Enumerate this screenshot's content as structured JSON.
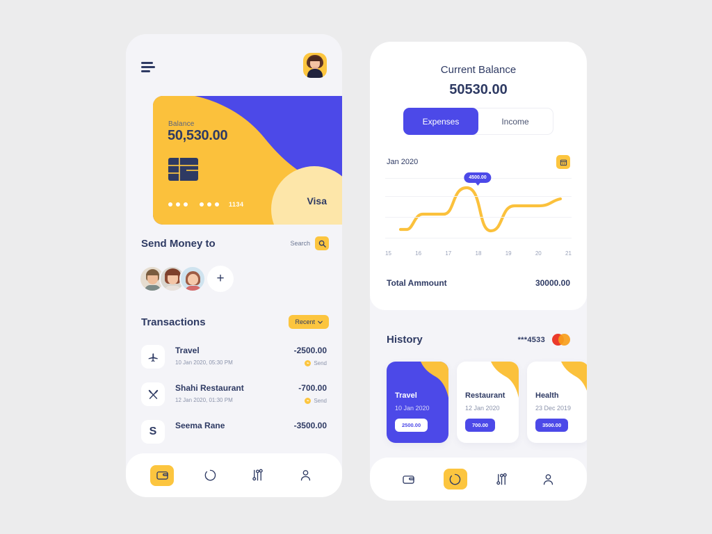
{
  "app": {
    "background_color": "#ececed",
    "accent_yellow": "#fcc53f",
    "accent_blue": "#4c49e8",
    "text_dark": "#2e3a63"
  },
  "left_screen": {
    "menu_icon": "hamburger-icon",
    "profile_avatar": "user-avatar",
    "card": {
      "balance_label": "Balance",
      "balance_value": "50,530.00",
      "chip_icon": "card-chip-icon",
      "masked_digits": [
        "•••",
        "•••"
      ],
      "last_four": "1134",
      "brand": "Visa"
    },
    "send_money": {
      "title": "Send Money to",
      "search_label": "Search",
      "search_icon": "search-icon",
      "add_label": "+",
      "friends": [
        {
          "name": "friend-1-avatar"
        },
        {
          "name": "friend-2-avatar"
        },
        {
          "name": "friend-3-avatar"
        }
      ]
    },
    "transactions": {
      "title": "Transactions",
      "filter_label": "Recent",
      "filter_icon": "chevron-down-icon",
      "items": [
        {
          "icon": "airplane-icon",
          "name": "Travel",
          "date": "10 Jan 2020, 05:30 PM",
          "amount": "-2500.00",
          "status": "Send"
        },
        {
          "icon": "cutlery-icon",
          "name": "Shahi Restaurant",
          "date": "12 Jan 2020, 01:30 PM",
          "amount": "-700.00",
          "status": "Send"
        },
        {
          "icon": "initial-letter",
          "initial": "S",
          "name": "Seema Rane",
          "date": "",
          "amount": "-3500.00",
          "status": ""
        }
      ]
    },
    "nav": [
      {
        "icon": "wallet-icon",
        "active": true
      },
      {
        "icon": "chart-ring-icon",
        "active": false
      },
      {
        "icon": "sliders-icon",
        "active": false
      },
      {
        "icon": "user-icon",
        "active": false
      }
    ]
  },
  "right_screen": {
    "balance_label": "Current Balance",
    "balance_value": "50530.00",
    "tabs": [
      {
        "label": "Expenses",
        "active": true
      },
      {
        "label": "Income",
        "active": false
      }
    ],
    "month_label": "Jan 2020",
    "calendar_icon": "calendar-icon",
    "total": {
      "label": "Total Ammount",
      "value": "30000.00"
    },
    "history": {
      "title": "History",
      "card_number": "***4533",
      "card_brand_icon": "mastercard-icon",
      "cards": [
        {
          "name": "Travel",
          "date": "10 Jan 2020",
          "amount": "2500.00",
          "active": true
        },
        {
          "name": "Restaurant",
          "date": "12 Jan 2020",
          "amount": "700.00",
          "active": false
        },
        {
          "name": "Health",
          "date": "23 Dec 2019",
          "amount": "3500.00",
          "active": false
        }
      ]
    },
    "nav": [
      {
        "icon": "wallet-icon",
        "active": false
      },
      {
        "icon": "chart-ring-icon",
        "active": true
      },
      {
        "icon": "sliders-icon",
        "active": false
      },
      {
        "icon": "user-icon",
        "active": false
      }
    ]
  },
  "chart_data": {
    "type": "line",
    "title": "Jan 2020",
    "xlabel": "",
    "ylabel": "",
    "x": [
      15,
      16,
      17,
      18,
      19,
      20,
      21
    ],
    "tick_labels": [
      "15",
      "16",
      "17",
      "18",
      "19",
      "20",
      "21"
    ],
    "values": [
      900,
      2100,
      2150,
      4500,
      800,
      3200,
      3500
    ],
    "ylim": [
      0,
      5000
    ],
    "highlight": {
      "x": 18,
      "value": "4500.00"
    },
    "grid": true,
    "legend": "none",
    "line_color": "#fbc13c"
  }
}
